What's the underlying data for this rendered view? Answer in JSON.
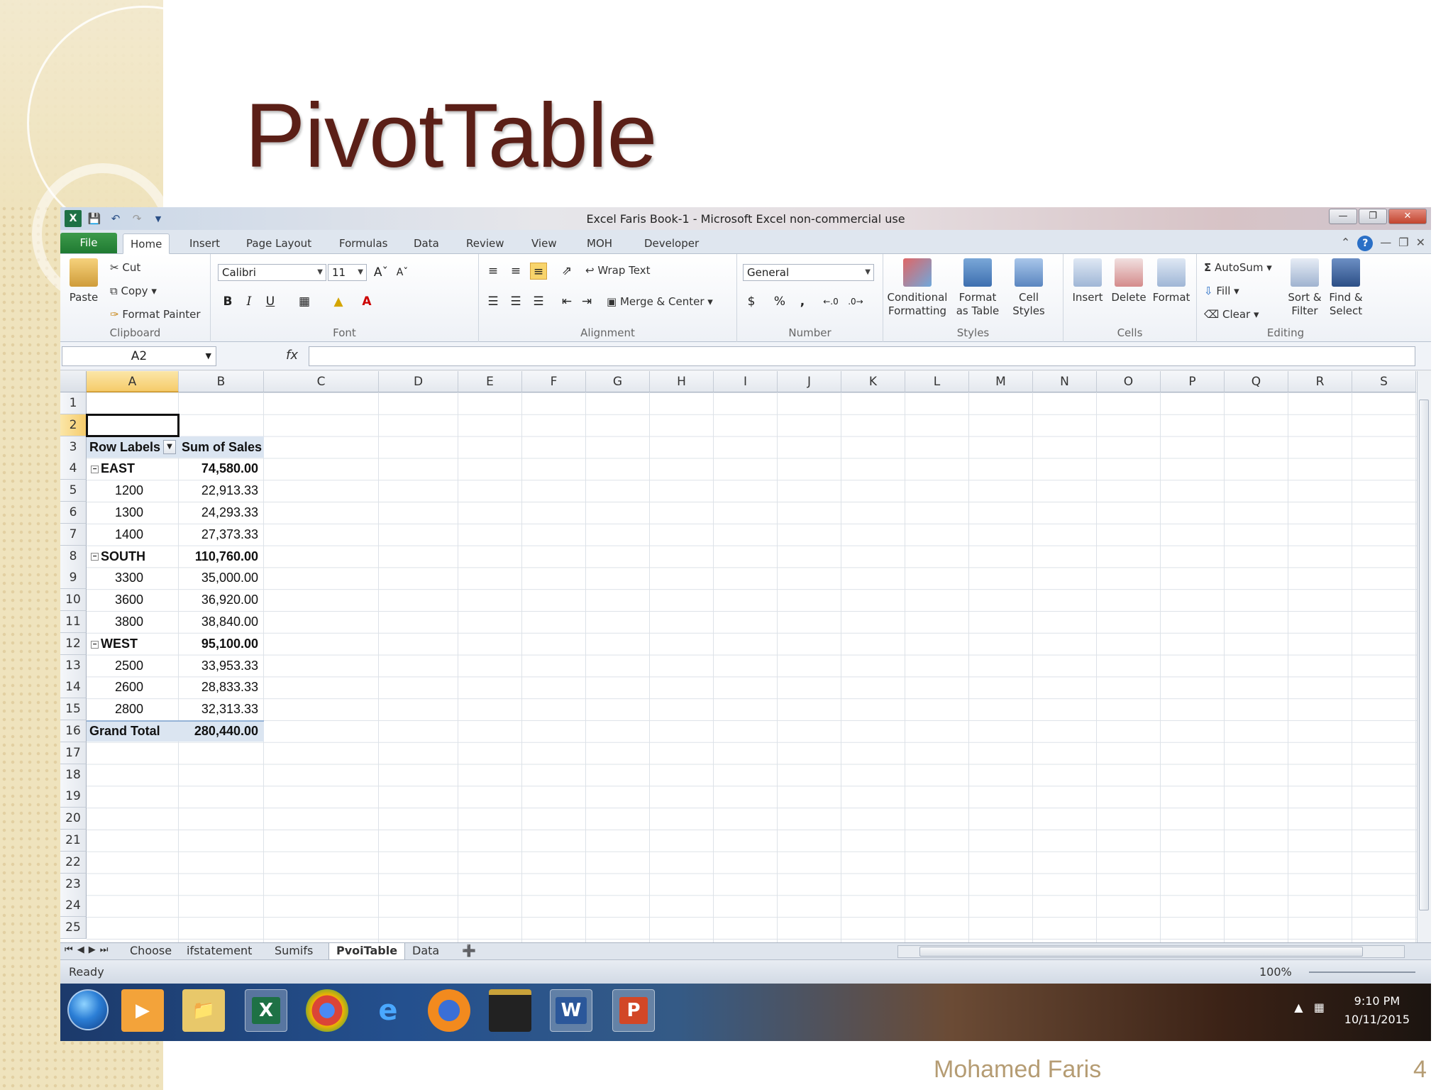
{
  "slide": {
    "title": "PivotTable",
    "author": "Mohamed Faris",
    "page_number": "4"
  },
  "window": {
    "title": "Excel Faris Book-1  -  Microsoft Excel non-commercial use",
    "qat_icons": [
      "excel-icon",
      "save-icon",
      "undo-icon",
      "redo-icon",
      "customize-icon"
    ]
  },
  "ribbon_tabs": {
    "file": "File",
    "items": [
      "Home",
      "Insert",
      "Page Layout",
      "Formulas",
      "Data",
      "Review",
      "View",
      "MOH",
      "Developer"
    ],
    "active": "Home"
  },
  "ribbon": {
    "clipboard": {
      "label": "Clipboard",
      "paste": "Paste",
      "cut": "Cut",
      "copy": "Copy",
      "format_painter": "Format Painter"
    },
    "font": {
      "label": "Font",
      "name": "Calibri",
      "size": "11",
      "bold": "B",
      "italic": "I",
      "underline": "U"
    },
    "alignment": {
      "label": "Alignment",
      "wrap_text": "Wrap Text",
      "merge_center": "Merge & Center"
    },
    "number": {
      "label": "Number",
      "format": "General",
      "currency": "$",
      "percent": "%",
      "comma": ","
    },
    "styles": {
      "label": "Styles",
      "conditional": [
        "Conditional",
        "Formatting"
      ],
      "format_table": [
        "Format",
        "as Table"
      ],
      "cell_styles": [
        "Cell",
        "Styles"
      ]
    },
    "cells": {
      "label": "Cells",
      "insert": "Insert",
      "delete": "Delete",
      "format": "Format"
    },
    "editing": {
      "label": "Editing",
      "autosum": "AutoSum",
      "fill": "Fill",
      "clear": "Clear",
      "sort_filter": [
        "Sort &",
        "Filter"
      ],
      "find_select": [
        "Find &",
        "Select"
      ]
    }
  },
  "formula_bar": {
    "name_box": "A2",
    "fx": "fx",
    "content": ""
  },
  "columns": [
    "A",
    "B",
    "C",
    "D",
    "E",
    "F",
    "G",
    "H",
    "I",
    "J",
    "K",
    "L",
    "M",
    "N",
    "O",
    "P",
    "Q",
    "R",
    "S"
  ],
  "selected_cell": "A2",
  "rows": [
    "1",
    "2",
    "3",
    "4",
    "5",
    "6",
    "7",
    "8",
    "9",
    "10",
    "11",
    "12",
    "13",
    "14",
    "15",
    "16",
    "17",
    "18",
    "19",
    "20",
    "21",
    "22",
    "23",
    "24",
    "25"
  ],
  "pivot": {
    "header": {
      "row_labels": "Row Labels",
      "sum_of_sales": "Sum of Sales"
    },
    "lines": [
      {
        "row": 4,
        "label": "EAST",
        "value": "74,580.00",
        "group": true
      },
      {
        "row": 5,
        "label": "1200",
        "value": "22,913.33",
        "group": false
      },
      {
        "row": 6,
        "label": "1300",
        "value": "24,293.33",
        "group": false
      },
      {
        "row": 7,
        "label": "1400",
        "value": "27,373.33",
        "group": false
      },
      {
        "row": 8,
        "label": "SOUTH",
        "value": "110,760.00",
        "group": true
      },
      {
        "row": 9,
        "label": "3300",
        "value": "35,000.00",
        "group": false
      },
      {
        "row": 10,
        "label": "3600",
        "value": "36,920.00",
        "group": false
      },
      {
        "row": 11,
        "label": "3800",
        "value": "38,840.00",
        "group": false
      },
      {
        "row": 12,
        "label": "WEST",
        "value": "95,100.00",
        "group": true
      },
      {
        "row": 13,
        "label": "2500",
        "value": "33,953.33",
        "group": false
      },
      {
        "row": 14,
        "label": "2600",
        "value": "28,833.33",
        "group": false
      },
      {
        "row": 15,
        "label": "2800",
        "value": "32,313.33",
        "group": false
      }
    ],
    "grand_total": {
      "label": "Grand Total",
      "value": "280,440.00"
    }
  },
  "sheets": {
    "items": [
      "Choose",
      "ifstatement",
      "Sumifs",
      "PvoiTable",
      "Data"
    ],
    "active": "PvoiTable"
  },
  "status": {
    "ready": "Ready",
    "zoom": "100%"
  },
  "taskbar": {
    "apps": [
      "start-icon",
      "media-player-icon",
      "file-explorer-icon",
      "excel-icon",
      "chrome-icon",
      "internet-explorer-icon",
      "firefox-icon",
      "kaaba-app-icon",
      "word-icon",
      "powerpoint-icon"
    ],
    "time": "9:10 PM",
    "date": "10/11/2015"
  }
}
